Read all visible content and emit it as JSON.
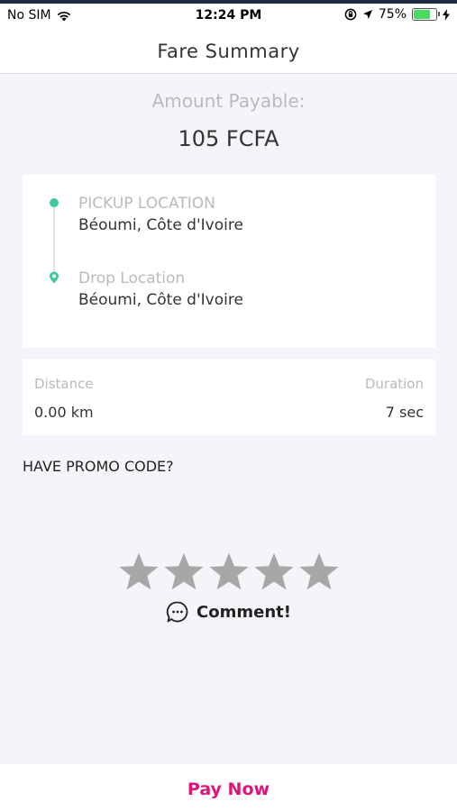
{
  "status_bar": {
    "carrier": "No SIM",
    "time": "12:24 PM",
    "battery_percent": "75%",
    "battery_level": 0.75,
    "icons": [
      "wifi-icon",
      "rotation-lock-icon",
      "location-arrow-icon",
      "battery-icon",
      "charging-bolt-icon"
    ]
  },
  "header": {
    "title": "Fare Summary"
  },
  "amount": {
    "label": "Amount Payable:",
    "value": "105 FCFA"
  },
  "pickup": {
    "label": "PICKUP LOCATION",
    "value": "Béoumi, Côte d'Ivoire"
  },
  "drop": {
    "label": "Drop Location",
    "value": "Béoumi, Côte d'Ivoire"
  },
  "trip": {
    "distance_label": "Distance",
    "distance_value": "0.00 km",
    "duration_label": "Duration",
    "duration_value": "7 sec"
  },
  "promo": {
    "label": "HAVE PROMO CODE?"
  },
  "rating": {
    "max_stars": 5,
    "selected": 0
  },
  "comment": {
    "label": "Comment!"
  },
  "pay": {
    "label": "Pay Now"
  },
  "colors": {
    "accent_green": "#3ec99a",
    "pay_pink": "#e0137c",
    "star_gray": "#a7a7a7",
    "background": "#f4f5f9"
  }
}
